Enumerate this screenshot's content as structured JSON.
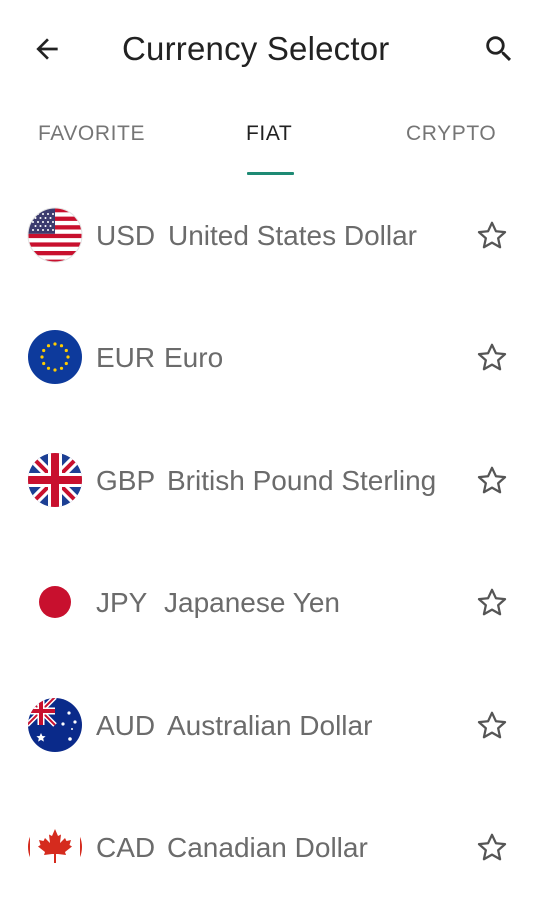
{
  "header": {
    "title": "Currency Selector",
    "back_icon": "arrow-left-icon",
    "search_icon": "search-icon"
  },
  "tabs": [
    {
      "label": "FAVORITE",
      "active": false
    },
    {
      "label": "FIAT",
      "active": true
    },
    {
      "label": "CRYPTO",
      "active": false
    }
  ],
  "colors": {
    "accent": "#1e8a74",
    "text_primary": "#222222",
    "text_secondary": "#6b6b6b"
  },
  "currencies": [
    {
      "code": "USD",
      "name": "United States Dollar",
      "flag": "us-flag-icon",
      "favorite": false
    },
    {
      "code": "EUR",
      "name": "Euro",
      "flag": "eu-flag-icon",
      "favorite": false
    },
    {
      "code": "GBP",
      "name": "British Pound Sterling",
      "flag": "uk-flag-icon",
      "favorite": false
    },
    {
      "code": "JPY",
      "name": "Japanese Yen",
      "flag": "jp-flag-icon",
      "favorite": false
    },
    {
      "code": "AUD",
      "name": "Australian Dollar",
      "flag": "au-flag-icon",
      "favorite": false
    },
    {
      "code": "CAD",
      "name": "Canadian Dollar",
      "flag": "ca-flag-icon",
      "favorite": false
    }
  ]
}
